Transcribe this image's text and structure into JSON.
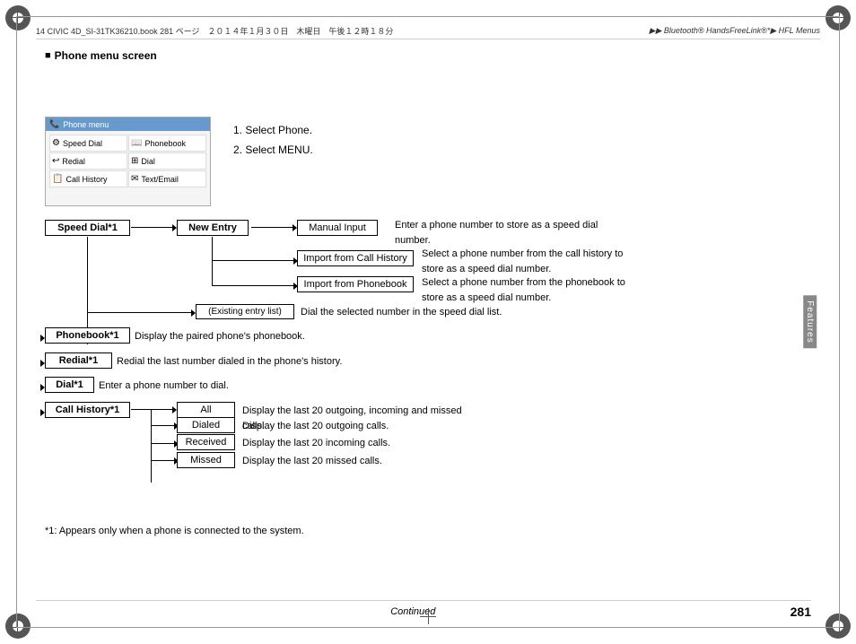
{
  "page": {
    "number": "281",
    "continued": "Continued",
    "footnote": "*1: Appears only when a phone is connected to the system."
  },
  "header": {
    "file_info": "14 CIVIC 4D_SI-31TK36210.book  281 ページ　２０１４年１月３０日　木曜日　午後１２時１８分",
    "breadcrumb": "▶▶ Bluetooth® HandsFreeLink®*▶ HFL Menus"
  },
  "sidebar": {
    "label": "Features"
  },
  "section": {
    "heading": "Phone menu screen",
    "instruction": {
      "step1": "1. Select Phone.",
      "step2": "2. Select MENU."
    }
  },
  "phone_menu": {
    "title": "Phone menu",
    "items": [
      {
        "icon": "⚙",
        "label": "Speed Dial"
      },
      {
        "icon": "📖",
        "label": "Phonebook"
      },
      {
        "icon": "↩",
        "label": "Redial"
      },
      {
        "icon": "⊞",
        "label": "Dial"
      },
      {
        "icon": "📋",
        "label": "Call History"
      },
      {
        "icon": "✉",
        "label": "Text/Email"
      }
    ]
  },
  "diagram": {
    "nodes": {
      "speed_dial": "Speed Dial*1",
      "new_entry": "New Entry",
      "manual_input": "Manual Input",
      "import_call_history": "Import from Call History",
      "import_phonebook": "Import from Phonebook",
      "existing_entry": "(Existing entry list)",
      "phonebook": "Phonebook*1",
      "redial": "Redial*1",
      "dial": "Dial*1",
      "call_history": "Call History*1",
      "all": "All",
      "dialed": "Dialed",
      "received": "Received",
      "missed": "Missed"
    },
    "descriptions": {
      "manual_input": "Enter a phone number to store as a speed dial number.",
      "import_call_history": "Select a phone number from the call history to store as a speed dial number.",
      "import_phonebook": "Select a phone number from the phonebook to store as a speed dial number.",
      "existing_entry": "Dial the selected number in the speed dial list.",
      "phonebook": "Display the paired phone's phonebook.",
      "redial": "Redial the last number dialed in the phone's history.",
      "dial": "Enter a phone number to dial.",
      "all": "Display the last 20 outgoing, incoming and missed calls.",
      "dialed": "Display the last 20 outgoing calls.",
      "received": "Display the last 20 incoming calls.",
      "missed": "Display the last 20 missed calls."
    }
  }
}
